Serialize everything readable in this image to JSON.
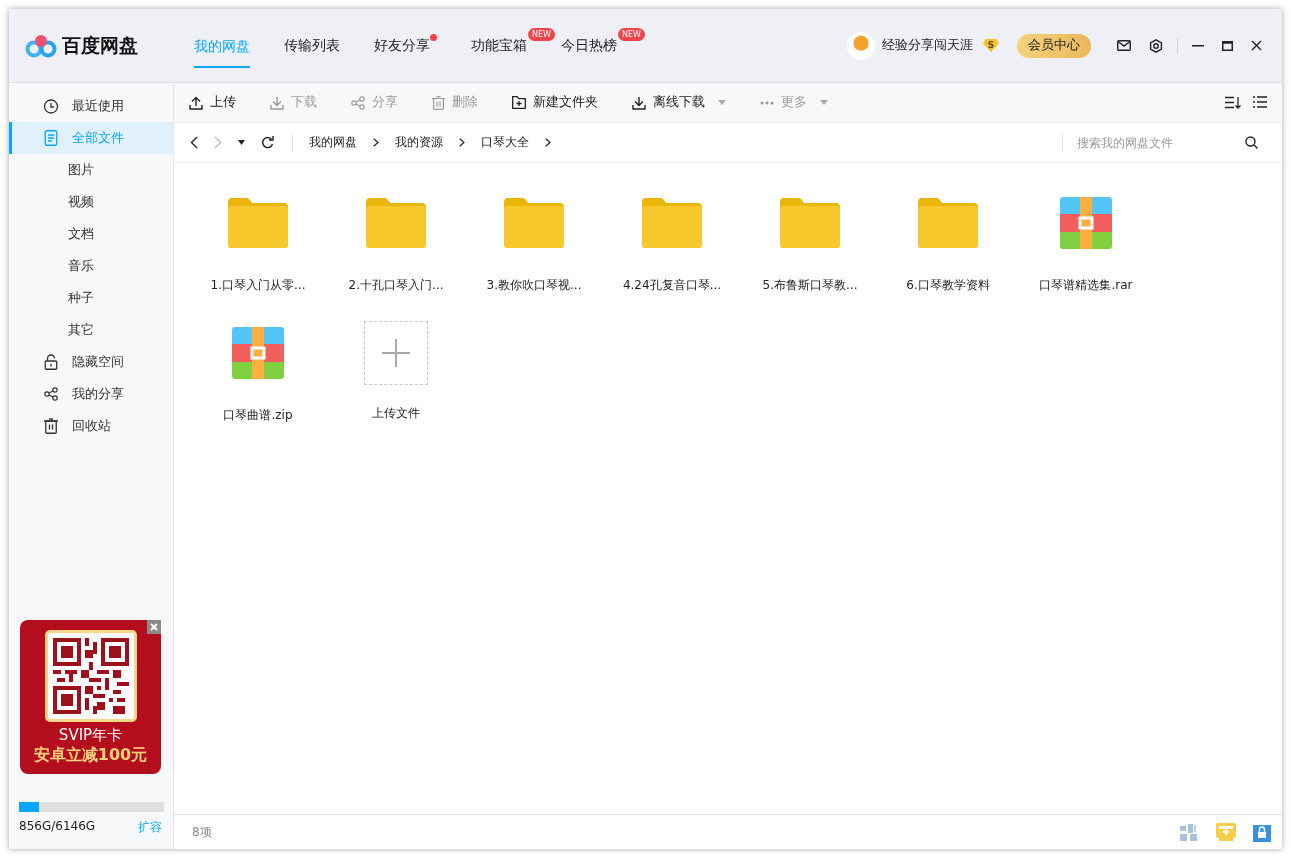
{
  "header": {
    "logo": "百度网盘",
    "tabs": [
      {
        "label": "我的网盘",
        "selected": true,
        "dot": false
      },
      {
        "label": "传输列表",
        "selected": false,
        "dot": false
      },
      {
        "label": "好友分享",
        "selected": false,
        "dot": true
      },
      {
        "label": "功能宝箱",
        "selected": false,
        "dot": false,
        "badge": "NEW"
      },
      {
        "label": "今日热榜",
        "selected": false,
        "dot": false,
        "badge": "NEW"
      }
    ],
    "user": {
      "name": "经验分享闯天涯",
      "vip": "S"
    },
    "member_button": "会员中心"
  },
  "sidebar": {
    "items": [
      {
        "label": "最近使用",
        "kind": "clock",
        "selected": false
      },
      {
        "label": "全部文件",
        "kind": "file",
        "selected": true,
        "children": [
          {
            "label": "图片",
            "selected": false
          },
          {
            "label": "视频",
            "selected": false
          },
          {
            "label": "文档",
            "selected": false
          },
          {
            "label": "音乐",
            "selected": false
          },
          {
            "label": "种子",
            "selected": false
          },
          {
            "label": "其它",
            "selected": false
          }
        ]
      },
      {
        "label": "隐藏空间",
        "kind": "lock",
        "selected": false
      },
      {
        "label": "我的分享",
        "kind": "share",
        "selected": false
      },
      {
        "label": "回收站",
        "kind": "trash",
        "selected": false
      }
    ],
    "ad": {
      "line1": "SVIP年卡",
      "line2": "安卓立减100元"
    },
    "storage": {
      "level": 0.14,
      "text": "856G/6146G",
      "link": "扩容"
    }
  },
  "toolbar": {
    "actions": [
      {
        "label": "上传",
        "kind": "upload",
        "disabled": false,
        "dropdown": false
      },
      {
        "label": "下载",
        "kind": "download",
        "disabled": true,
        "dropdown": false
      },
      {
        "label": "分享",
        "kind": "share",
        "disabled": true,
        "dropdown": false
      },
      {
        "label": "删除",
        "kind": "trash",
        "disabled": true,
        "dropdown": false
      },
      {
        "label": "新建文件夹",
        "kind": "folder-plus",
        "disabled": false,
        "dropdown": false
      },
      {
        "label": "离线下载",
        "kind": "download",
        "disabled": false,
        "dropdown": true
      },
      {
        "label": "更多",
        "kind": "dots",
        "disabled": true,
        "dropdown": true
      }
    ]
  },
  "breadcrumb": {
    "path": [
      "我的网盘",
      "我的资源",
      "口琴大全"
    ],
    "search_placeholder": "搜索我的网盘文件"
  },
  "files": [
    {
      "name": "1.口琴入门从零...",
      "kind": "folder"
    },
    {
      "name": "2.十孔口琴入门...",
      "kind": "folder"
    },
    {
      "name": "3.教你吹口琴视...",
      "kind": "folder"
    },
    {
      "name": "4.24孔复音口琴...",
      "kind": "folder"
    },
    {
      "name": "5.布鲁斯口琴教...",
      "kind": "folder"
    },
    {
      "name": "6.口琴教学资料",
      "kind": "folder"
    },
    {
      "name": "口琴谱精选集.rar",
      "kind": "archive"
    },
    {
      "name": "口琴曲谱.zip",
      "kind": "archive"
    },
    {
      "name": "上传文件",
      "kind": "upload"
    }
  ],
  "status_bar": {
    "count": "8项"
  }
}
